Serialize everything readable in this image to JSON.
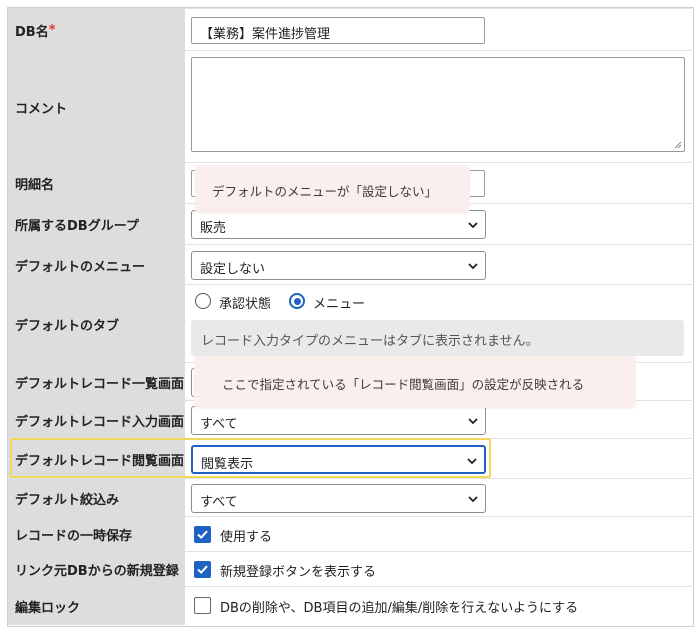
{
  "rows": {
    "db_name": {
      "label": "DB名",
      "required_mark": "*",
      "value": "【業務】案件進捗管理"
    },
    "comment": {
      "label": "コメント",
      "value": ""
    },
    "detail_name": {
      "label": "明細名",
      "value": ""
    },
    "db_group": {
      "label": "所属するDBグループ",
      "value": "販売"
    },
    "default_menu": {
      "label": "デフォルトのメニュー",
      "value": "設定しない"
    },
    "default_tab": {
      "label": "デフォルトのタブ",
      "options": [
        {
          "label": "承認状態",
          "checked": false
        },
        {
          "label": "メニュー",
          "checked": true
        }
      ],
      "note": "レコード入力タイプのメニューはタブに表示されません。"
    },
    "record_list_view": {
      "label": "デフォルトレコード一覧画面",
      "value": ""
    },
    "record_input_view": {
      "label": "デフォルトレコード入力画面",
      "value": "すべて"
    },
    "record_browse_view": {
      "label": "デフォルトレコード閲覧画面",
      "value": "閲覧表示"
    },
    "default_filter": {
      "label": "デフォルト絞込み",
      "value": "すべて"
    },
    "temp_save": {
      "label": "レコードの一時保存",
      "checkbox_label": "使用する",
      "checked": true
    },
    "link_register": {
      "label": "リンク元DBからの新規登録",
      "checkbox_label": "新規登録ボタンを表示する",
      "checked": true
    },
    "edit_lock": {
      "label": "編集ロック",
      "checkbox_label": "DBの削除や、DB項目の追加/編集/削除を行えないようにする",
      "checked": false
    }
  },
  "callouts": {
    "menu_note": "デフォルトのメニューが「設定しない」",
    "browse_note": "ここで指定されている「レコード閲覧画面」の設定が反映される"
  },
  "colors": {
    "accent": "#1e63c4",
    "highlight": "#f1d85c",
    "label_bg": "#dddddd",
    "required": "#dd3333",
    "callout_bg": "#fbefee"
  },
  "icons": {
    "select_chevron": "chevron-down-icon",
    "checkbox_check": "check-icon",
    "resize": "resize-grip-icon"
  }
}
